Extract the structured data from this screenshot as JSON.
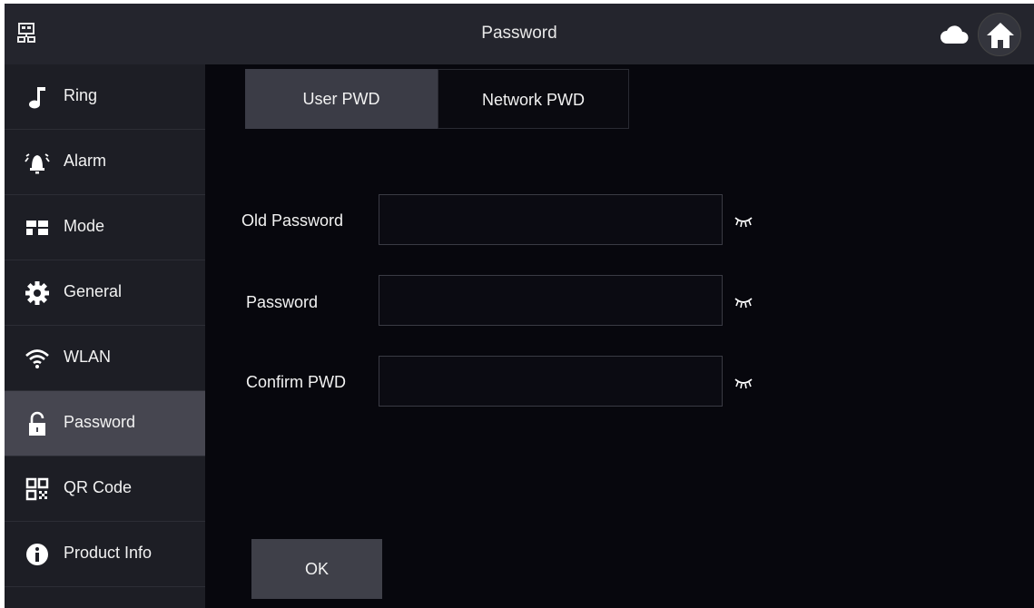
{
  "header": {
    "title": "Password",
    "left_icon": "network-icon",
    "cloud_icon": "cloud-icon",
    "home_icon": "home-icon"
  },
  "sidebar": {
    "items": [
      {
        "label": "Ring",
        "icon": "music-note-icon"
      },
      {
        "label": "Alarm",
        "icon": "alarm-bell-icon"
      },
      {
        "label": "Mode",
        "icon": "grid-icon"
      },
      {
        "label": "General",
        "icon": "gear-icon"
      },
      {
        "label": "WLAN",
        "icon": "wifi-icon"
      },
      {
        "label": "Password",
        "icon": "unlock-icon",
        "active": true
      },
      {
        "label": "QR Code",
        "icon": "qr-code-icon"
      },
      {
        "label": "Product Info",
        "icon": "info-icon"
      }
    ]
  },
  "tabs": [
    {
      "label": "User PWD",
      "active": true
    },
    {
      "label": "Network PWD",
      "active": false
    }
  ],
  "form": {
    "old_password": {
      "label": "Old Password",
      "value": ""
    },
    "password": {
      "label": "Password",
      "value": ""
    },
    "confirm": {
      "label": "Confirm PWD",
      "value": ""
    }
  },
  "ok_button": {
    "label": "OK"
  },
  "colors": {
    "background": "#07070d",
    "topbar": "#24252d",
    "sidebar": "#1d1e25",
    "active_item": "#464650",
    "active_tab": "#3b3c46",
    "button": "#3f4049"
  }
}
